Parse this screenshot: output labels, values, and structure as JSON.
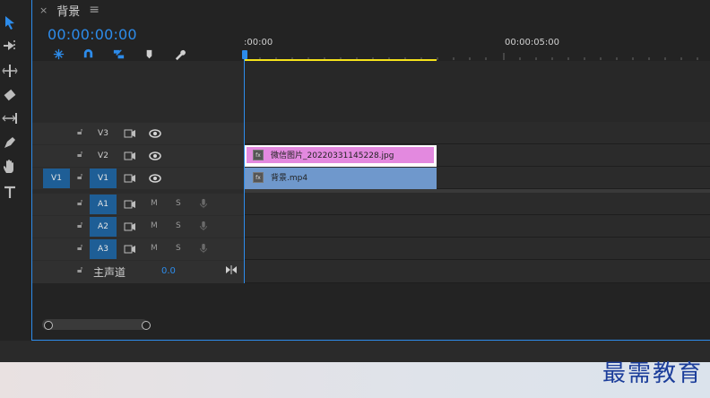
{
  "panel": {
    "tab_title": "背景",
    "close_glyph": "×",
    "menu_glyph": "≡"
  },
  "timecode": "00:00:00:00",
  "ruler": {
    "start_label": ":00:00",
    "mark_label": "00:00:05:00",
    "accent": "#f5e21b"
  },
  "tools": [
    "selection-tool",
    "track-select-forward-tool",
    "ripple-edit-tool",
    "razor-tool",
    "slip-tool",
    "pen-tool",
    "hand-tool",
    "type-tool"
  ],
  "video_tracks": [
    {
      "source": "",
      "label": "V3"
    },
    {
      "source": "",
      "label": "V2"
    },
    {
      "source": "V1",
      "label": "V1"
    }
  ],
  "audio_tracks": [
    {
      "label": "A1",
      "m": "M",
      "s": "S"
    },
    {
      "label": "A2",
      "m": "M",
      "s": "S"
    },
    {
      "label": "A3",
      "m": "M",
      "s": "S"
    }
  ],
  "master": {
    "label": "主声道",
    "value": "0.0"
  },
  "clips": {
    "image": {
      "name": "微信图片_20220331145228.jpg",
      "fx": "fx",
      "color": "#e389df"
    },
    "video": {
      "name": "背景.mp4",
      "fx": "fx",
      "color": "#6f98cc"
    }
  },
  "watermark": "最需教育",
  "colors": {
    "accent": "#2d8ceb",
    "track_on": "#1e5e96"
  }
}
